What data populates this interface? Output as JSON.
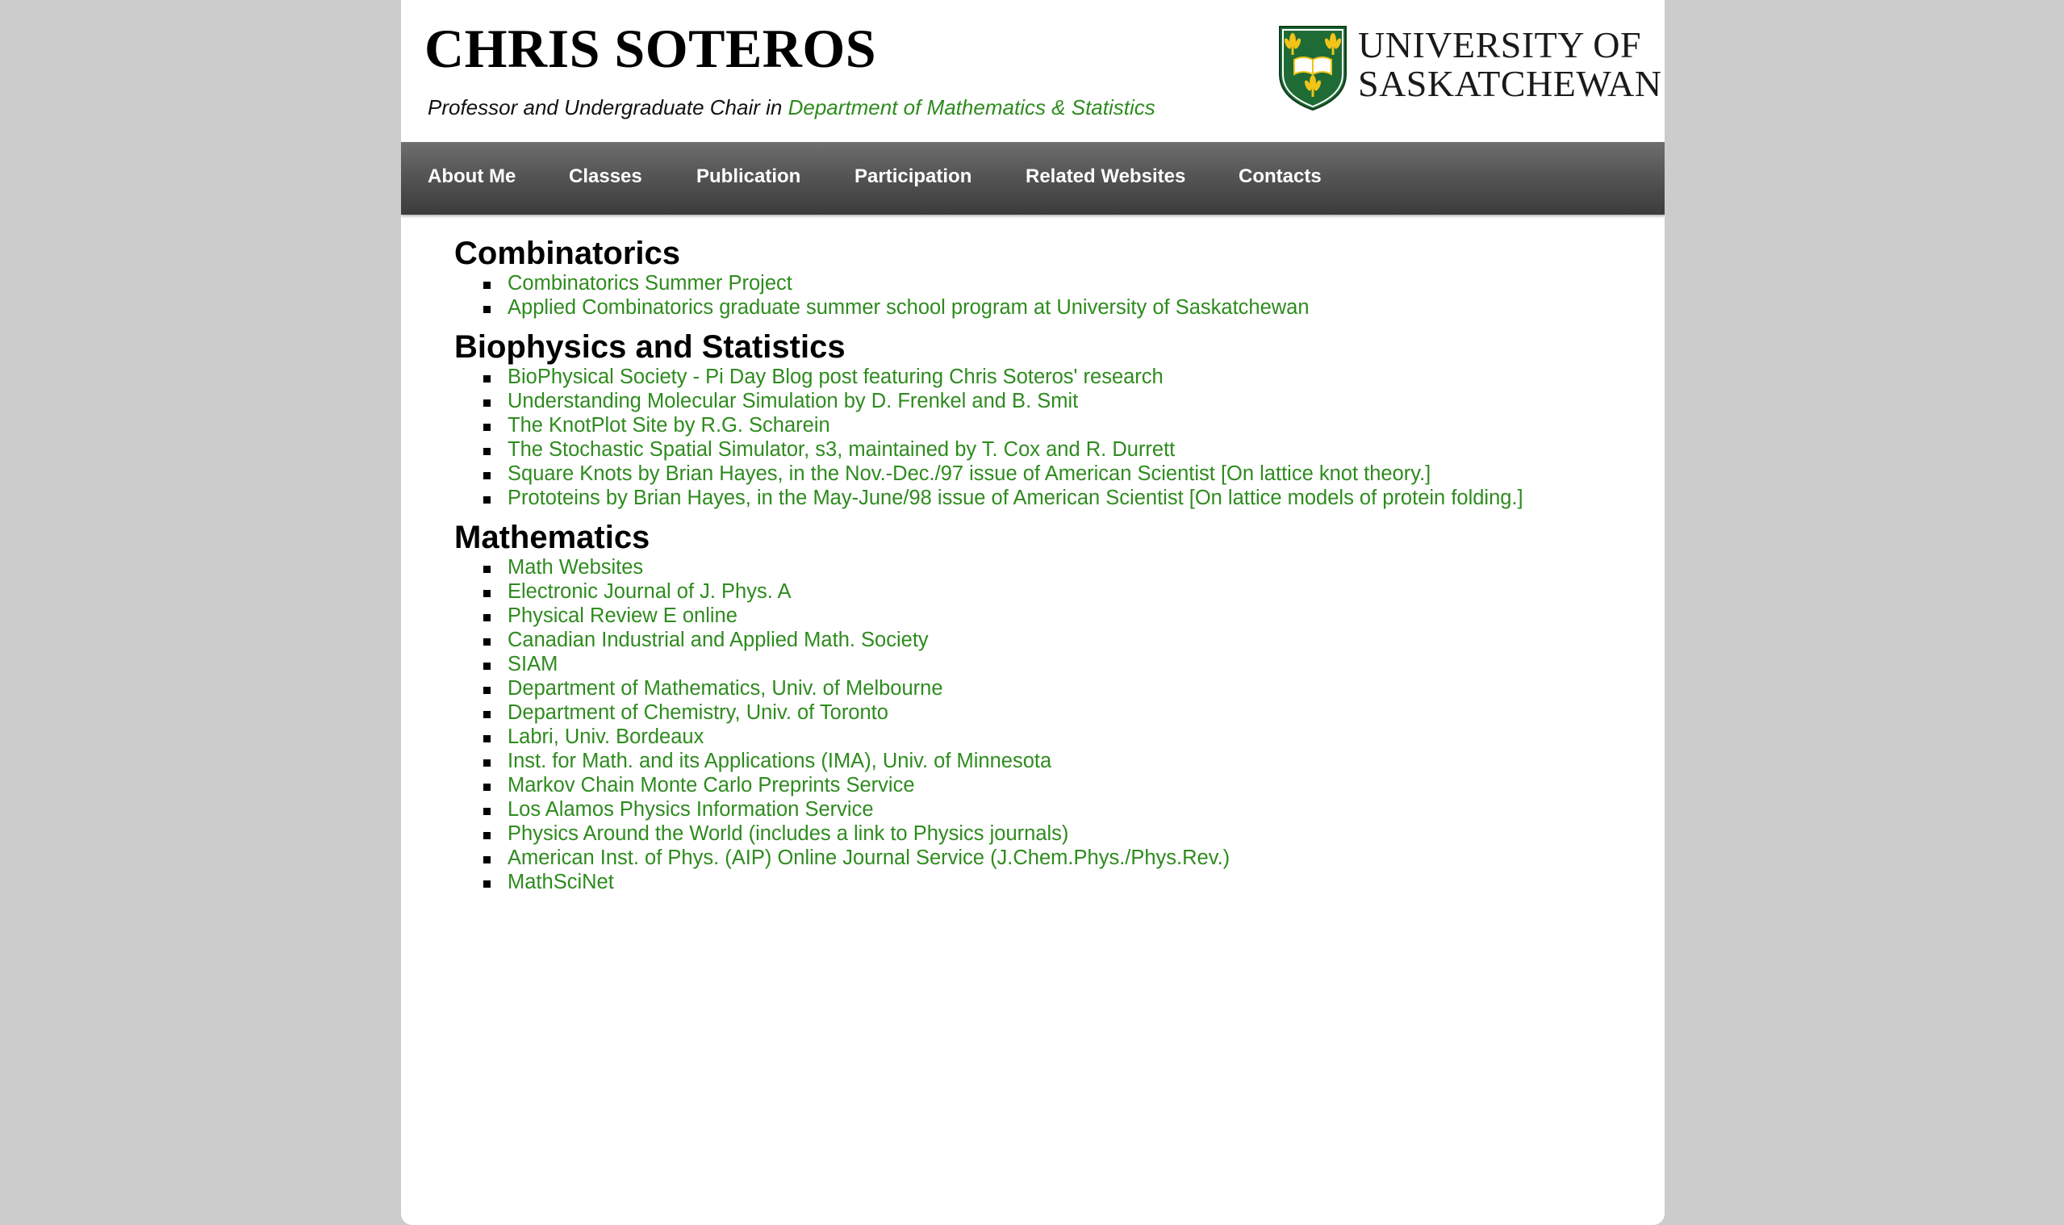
{
  "header": {
    "name": "CHRIS SOTEROS",
    "subtitle_prefix": "Professor and Undergraduate Chair in ",
    "department_link": "Department of Mathematics & Statistics",
    "logo_line1": "UNIVERSITY OF",
    "logo_line2": "SASKATCHEWAN",
    "crest_colors": {
      "green": "#1f6b35",
      "gold": "#f2c418",
      "white": "#ffffff"
    }
  },
  "nav": {
    "items": [
      "About Me",
      "Classes",
      "Publication",
      "Participation",
      "Related Websites",
      "Contacts"
    ]
  },
  "sections": [
    {
      "title": "Combinatorics",
      "links": [
        "Combinatorics Summer Project",
        "Applied Combinatorics graduate summer school program at University of Saskatchewan"
      ]
    },
    {
      "title": "Biophysics and Statistics",
      "links": [
        "BioPhysical Society - Pi Day Blog post featuring Chris Soteros' research",
        "Understanding Molecular Simulation by D. Frenkel and B. Smit",
        "The KnotPlot Site by R.G. Scharein",
        "The Stochastic Spatial Simulator, s3, maintained by T. Cox and R. Durrett",
        "Square Knots by Brian Hayes, in the Nov.-Dec./97 issue of American Scientist [On lattice knot theory.]",
        "Prototeins by Brian Hayes, in the May-June/98 issue of American Scientist [On lattice models of protein folding.]"
      ]
    },
    {
      "title": "Mathematics",
      "links": [
        "Math Websites",
        "Electronic Journal of J. Phys. A",
        "Physical Review E online",
        "Canadian Industrial and Applied Math. Society",
        "SIAM",
        "Department of Mathematics, Univ. of Melbourne",
        "Department of Chemistry, Univ. of Toronto",
        "Labri, Univ. Bordeaux",
        "Inst. for Math. and its Applications (IMA), Univ. of Minnesota",
        "Markov Chain Monte Carlo Preprints Service",
        "Los Alamos Physics Information Service",
        "Physics Around the World (includes a link to Physics journals)",
        "American Inst. of Phys. (AIP) Online Journal Service (J.Chem.Phys./Phys.Rev.)",
        "MathSciNet"
      ]
    }
  ],
  "colors": {
    "link": "#2e8b1e",
    "background": "#cccccc",
    "nav": "#4a4a4a"
  }
}
